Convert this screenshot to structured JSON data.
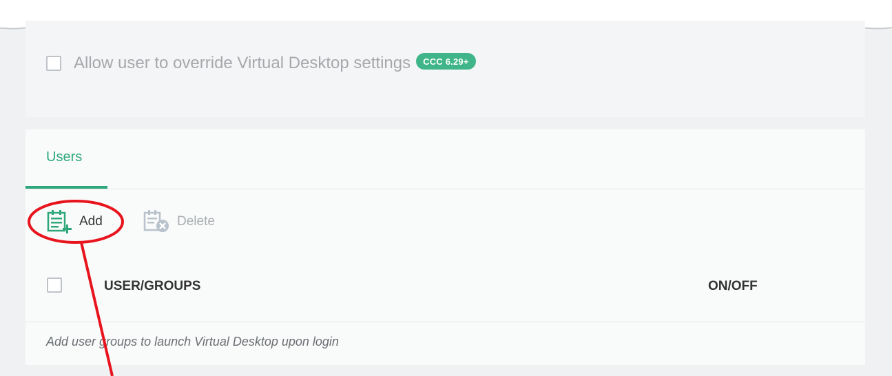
{
  "settings": {
    "override_label": "Allow user to override Virtual Desktop settings",
    "version_badge": "CCC 6.29+"
  },
  "tabs": {
    "users_label": "Users"
  },
  "toolbar": {
    "add_label": "Add",
    "delete_label": "Delete"
  },
  "table": {
    "columns": [
      "USER/GROUPS",
      "ON/OFF"
    ],
    "empty_message": "Add user groups to launch Virtual Desktop upon login"
  },
  "colors": {
    "accent": "#2ea87b",
    "badge": "#3fb589",
    "annotation": "#e8141d"
  },
  "icons": {
    "add": "clipboard-add-icon",
    "delete": "clipboard-delete-icon"
  }
}
